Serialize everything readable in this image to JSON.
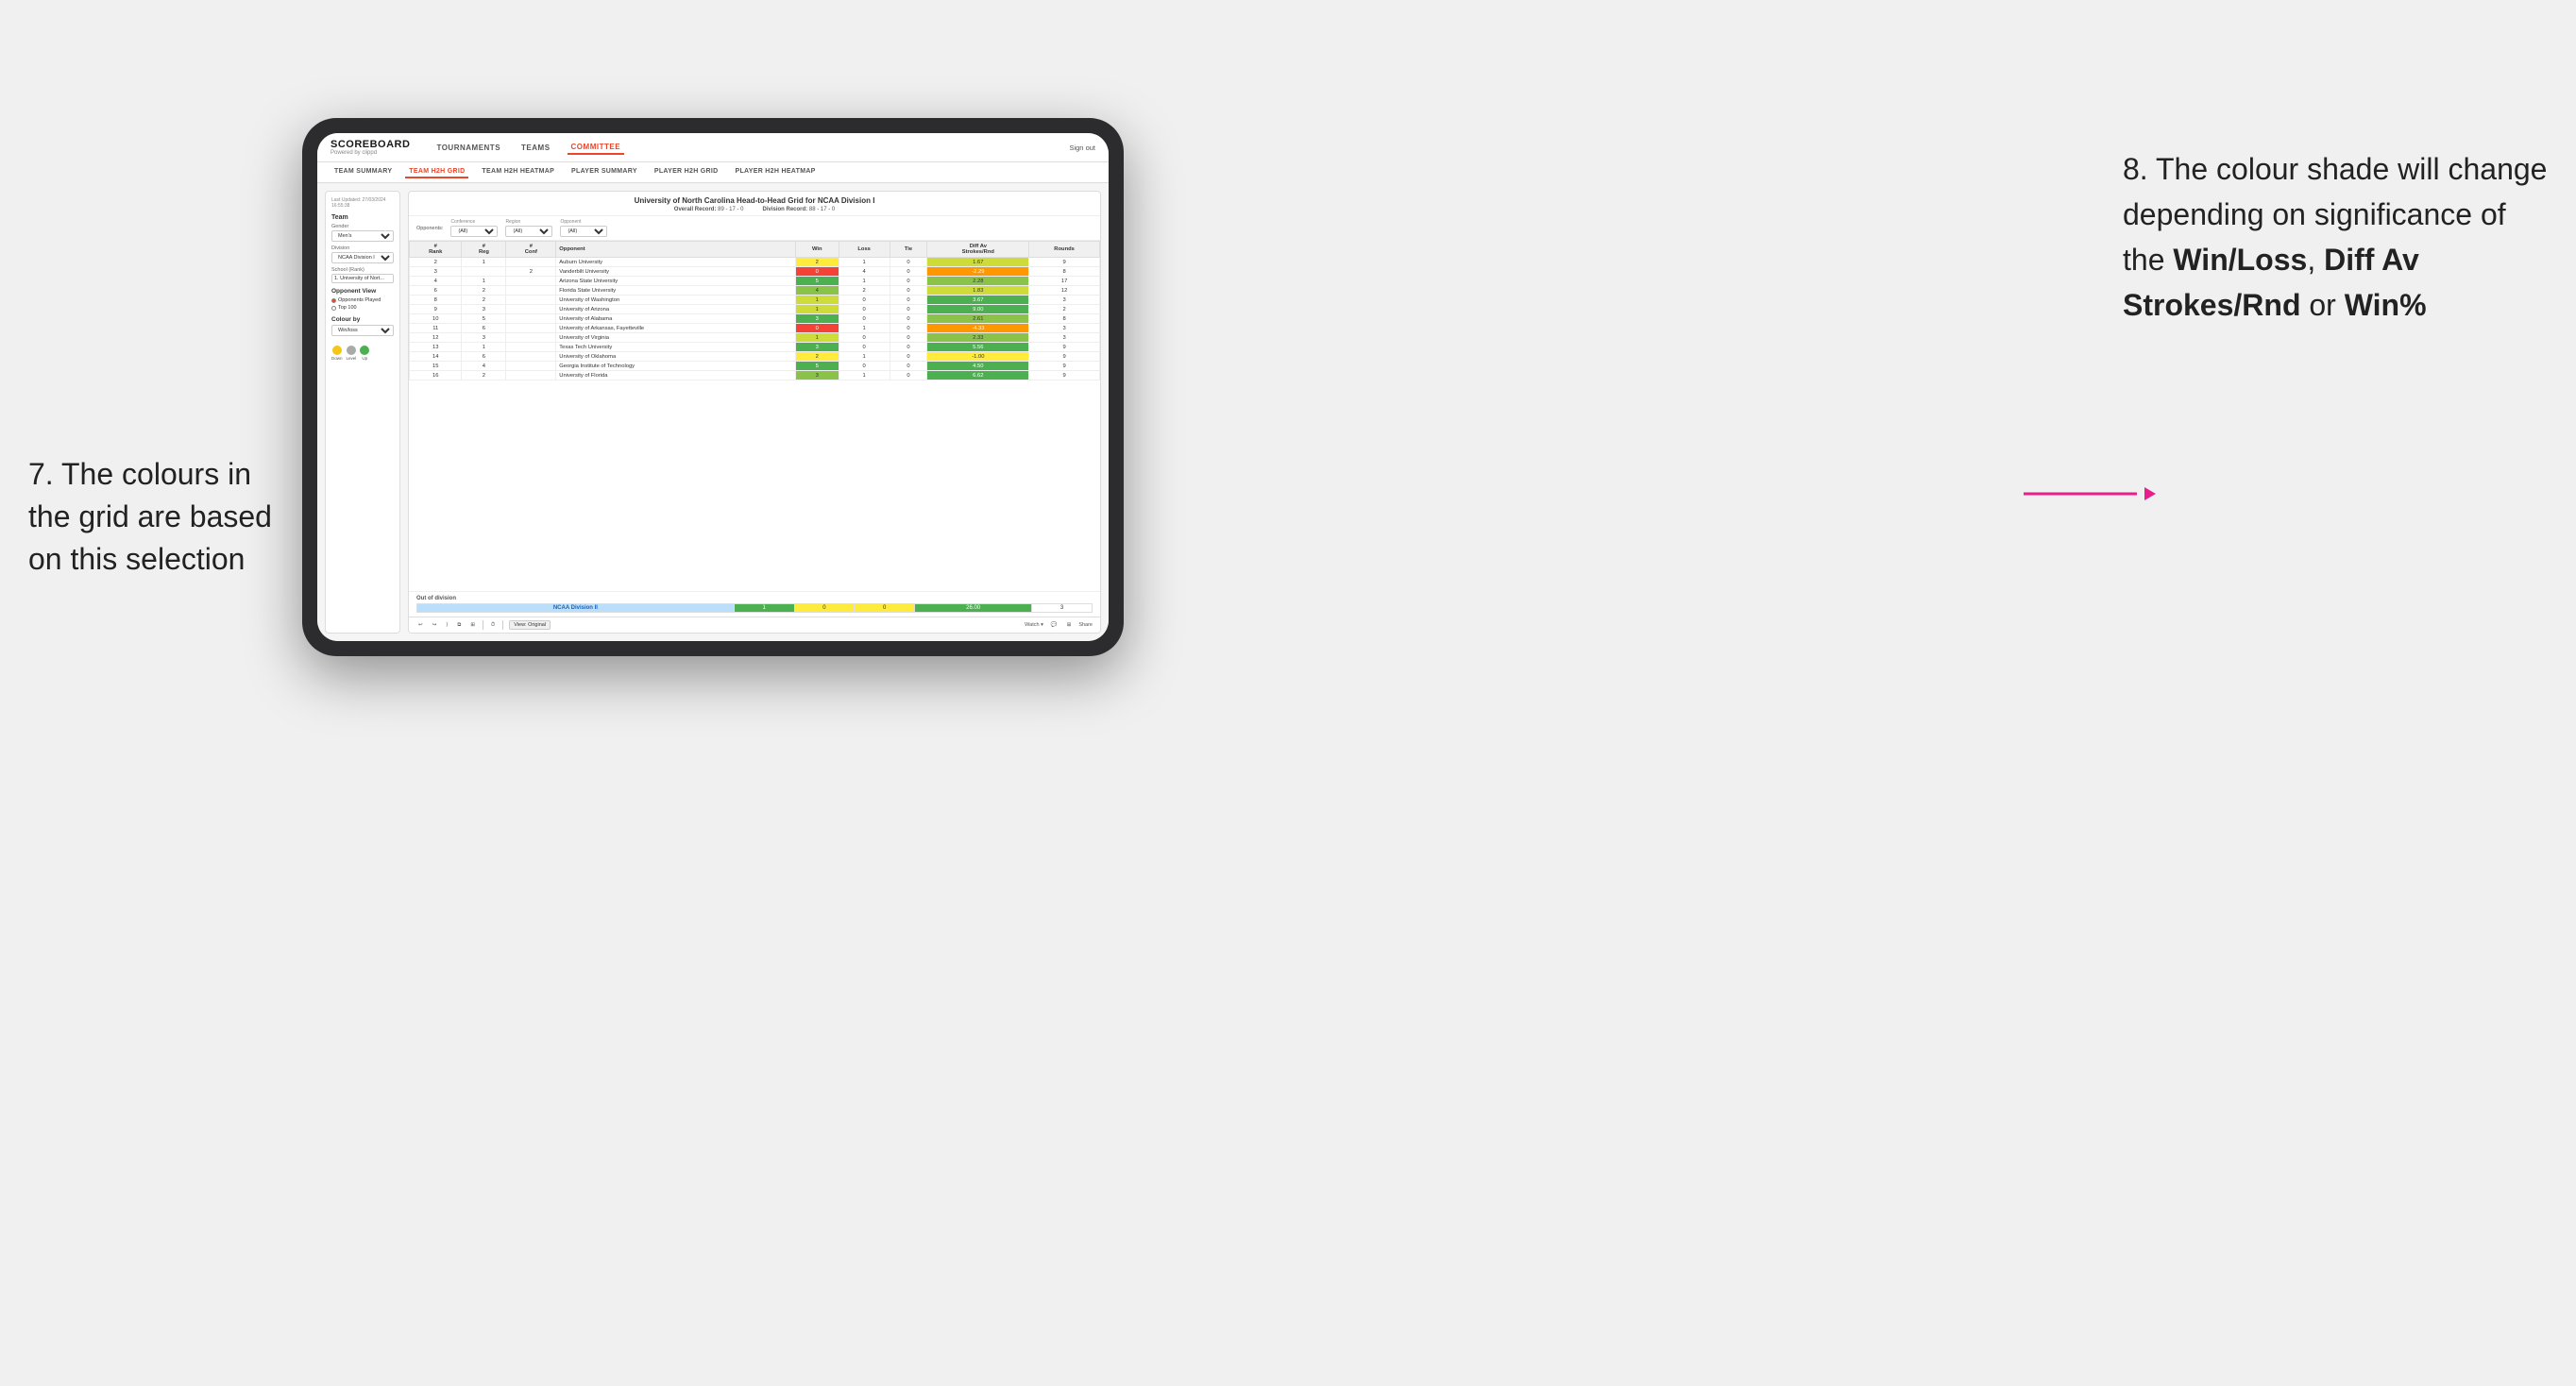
{
  "annotations": {
    "left": {
      "number": "7.",
      "text": "The colours in the grid are based on this selection"
    },
    "right": {
      "number": "8.",
      "intro": "The colour shade will change depending on significance of the",
      "bold1": "Win/Loss",
      "comma": ", ",
      "bold2": "Diff Av Strokes/Rnd",
      "or": " or ",
      "bold3": "Win%"
    }
  },
  "app": {
    "logo": "SCOREBOARD",
    "logo_sub": "Powered by clippd",
    "nav": [
      "TOURNAMENTS",
      "TEAMS",
      "COMMITTEE"
    ],
    "sign_out": "Sign out",
    "sub_nav": [
      "TEAM SUMMARY",
      "TEAM H2H GRID",
      "TEAM H2H HEATMAP",
      "PLAYER SUMMARY",
      "PLAYER H2H GRID",
      "PLAYER H2H HEATMAP"
    ]
  },
  "left_panel": {
    "updated_label": "Last Updated: 27/03/2024",
    "updated_time": "16:55:38",
    "team_label": "Team",
    "gender_label": "Gender",
    "gender_value": "Men's",
    "division_label": "Division",
    "division_value": "NCAA Division I",
    "school_label": "School (Rank)",
    "school_value": "1. University of Nort...",
    "opponent_view_title": "Opponent View",
    "radio1": "Opponents Played",
    "radio2": "Top 100",
    "colour_by_label": "Colour by",
    "colour_by_value": "Win/loss",
    "legend": [
      {
        "color": "#f5c518",
        "label": "Down"
      },
      {
        "color": "#aaaaaa",
        "label": "Level"
      },
      {
        "color": "#4caf50",
        "label": "Up"
      }
    ]
  },
  "grid": {
    "title": "University of North Carolina Head-to-Head Grid for NCAA Division I",
    "overall_record_label": "Overall Record:",
    "overall_record": "89 - 17 - 0",
    "division_record_label": "Division Record:",
    "division_record": "88 - 17 - 0",
    "filters": {
      "conference_label": "Conference",
      "conference_value": "(All)",
      "region_label": "Region",
      "region_value": "(All)",
      "opponent_label": "Opponent",
      "opponent_value": "(All)"
    },
    "opponents_label": "Opponents:",
    "col_headers": [
      "#\nRank",
      "#\nReg",
      "#\nConf",
      "Opponent",
      "Win",
      "Loss",
      "Tie",
      "Diff Av\nStrokes/Rnd",
      "Rounds"
    ],
    "rows": [
      {
        "rank": "2",
        "reg": "1",
        "conf": "",
        "opponent": "Auburn University",
        "win": "2",
        "loss": "1",
        "tie": "0",
        "diff": "1.67",
        "rounds": "9",
        "win_color": "yellow",
        "diff_color": "green_light"
      },
      {
        "rank": "3",
        "reg": "",
        "conf": "2",
        "opponent": "Vanderbilt University",
        "win": "0",
        "loss": "4",
        "tie": "0",
        "diff": "-2.29",
        "rounds": "8",
        "win_color": "red",
        "diff_color": "orange"
      },
      {
        "rank": "4",
        "reg": "1",
        "conf": "",
        "opponent": "Arizona State University",
        "win": "5",
        "loss": "1",
        "tie": "0",
        "diff": "2.28",
        "rounds": "17",
        "win_color": "green_dark",
        "diff_color": "green_med"
      },
      {
        "rank": "6",
        "reg": "2",
        "conf": "",
        "opponent": "Florida State University",
        "win": "4",
        "loss": "2",
        "tie": "0",
        "diff": "1.83",
        "rounds": "12",
        "win_color": "green_med",
        "diff_color": "green_light"
      },
      {
        "rank": "8",
        "reg": "2",
        "conf": "",
        "opponent": "University of Washington",
        "win": "1",
        "loss": "0",
        "tie": "0",
        "diff": "3.67",
        "rounds": "3",
        "win_color": "green_light",
        "diff_color": "green_dark"
      },
      {
        "rank": "9",
        "reg": "3",
        "conf": "",
        "opponent": "University of Arizona",
        "win": "1",
        "loss": "0",
        "tie": "0",
        "diff": "9.00",
        "rounds": "2",
        "win_color": "green_light",
        "diff_color": "green_dark"
      },
      {
        "rank": "10",
        "reg": "5",
        "conf": "",
        "opponent": "University of Alabama",
        "win": "3",
        "loss": "0",
        "tie": "0",
        "diff": "2.61",
        "rounds": "8",
        "win_color": "green_dark",
        "diff_color": "green_med"
      },
      {
        "rank": "11",
        "reg": "6",
        "conf": "",
        "opponent": "University of Arkansas, Fayetteville",
        "win": "0",
        "loss": "1",
        "tie": "0",
        "diff": "-4.33",
        "rounds": "3",
        "win_color": "red",
        "diff_color": "orange"
      },
      {
        "rank": "12",
        "reg": "3",
        "conf": "",
        "opponent": "University of Virginia",
        "win": "1",
        "loss": "0",
        "tie": "0",
        "diff": "2.33",
        "rounds": "3",
        "win_color": "green_light",
        "diff_color": "green_med"
      },
      {
        "rank": "13",
        "reg": "1",
        "conf": "",
        "opponent": "Texas Tech University",
        "win": "3",
        "loss": "0",
        "tie": "0",
        "diff": "5.56",
        "rounds": "9",
        "win_color": "green_dark",
        "diff_color": "green_dark"
      },
      {
        "rank": "14",
        "reg": "6",
        "conf": "",
        "opponent": "University of Oklahoma",
        "win": "2",
        "loss": "1",
        "tie": "0",
        "diff": "-1.00",
        "rounds": "9",
        "win_color": "yellow",
        "diff_color": "yellow"
      },
      {
        "rank": "15",
        "reg": "4",
        "conf": "",
        "opponent": "Georgia Institute of Technology",
        "win": "5",
        "loss": "0",
        "tie": "0",
        "diff": "4.50",
        "rounds": "9",
        "win_color": "green_dark",
        "diff_color": "green_dark"
      },
      {
        "rank": "16",
        "reg": "2",
        "conf": "",
        "opponent": "University of Florida",
        "win": "3",
        "loss": "1",
        "tie": "0",
        "diff": "6.62",
        "rounds": "9",
        "win_color": "green_med",
        "diff_color": "green_dark"
      }
    ],
    "out_of_division": {
      "label": "Out of division",
      "name": "NCAA Division II",
      "win": "1",
      "loss": "0",
      "tie": "0",
      "diff": "26.00",
      "rounds": "3"
    }
  },
  "toolbar": {
    "view_label": "View: Original",
    "watch_label": "Watch ▾",
    "share_label": "Share"
  }
}
